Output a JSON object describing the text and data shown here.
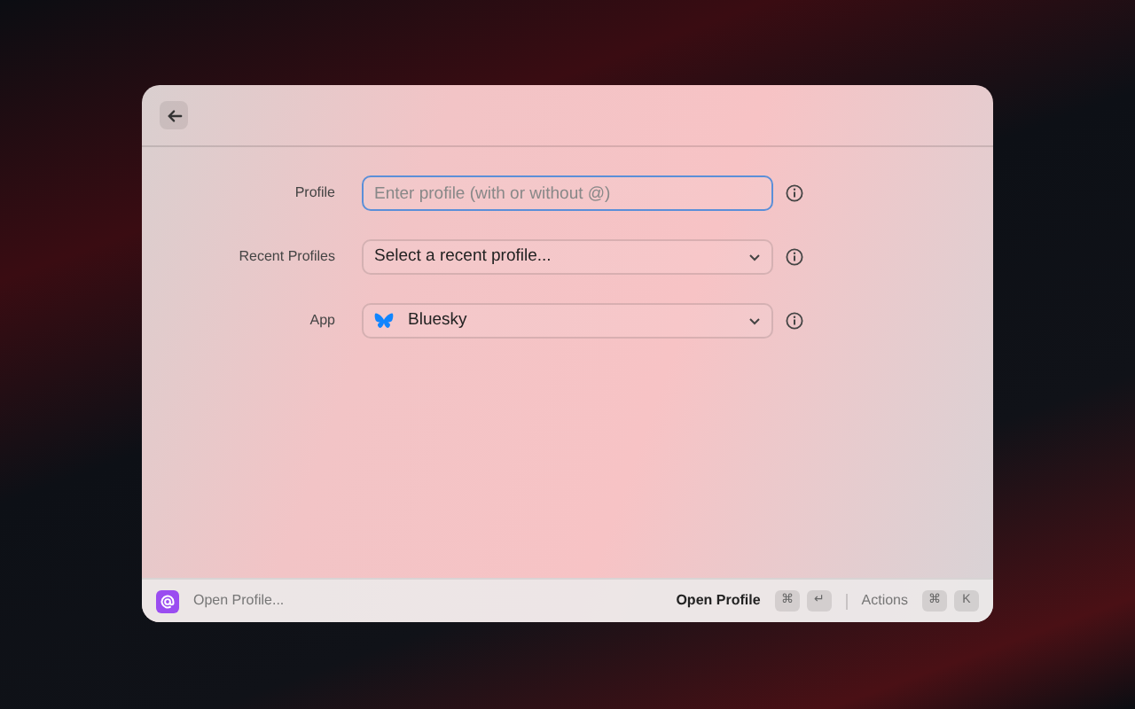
{
  "form": {
    "fields": [
      {
        "label": "Profile",
        "kind": "text",
        "placeholder": "Enter profile (with or without @)",
        "focused": true
      },
      {
        "label": "Recent Profiles",
        "kind": "select",
        "value": "Select a recent profile...",
        "focused": false
      },
      {
        "label": "App",
        "kind": "select",
        "value": "Bluesky",
        "app_icon": true,
        "focused": false
      }
    ]
  },
  "footer": {
    "command": "Open Profile...",
    "primary_action": "Open Profile",
    "primary_keys": [
      "⌘",
      "↵"
    ],
    "secondary_action": "Actions",
    "secondary_keys": [
      "⌘",
      "K"
    ]
  }
}
